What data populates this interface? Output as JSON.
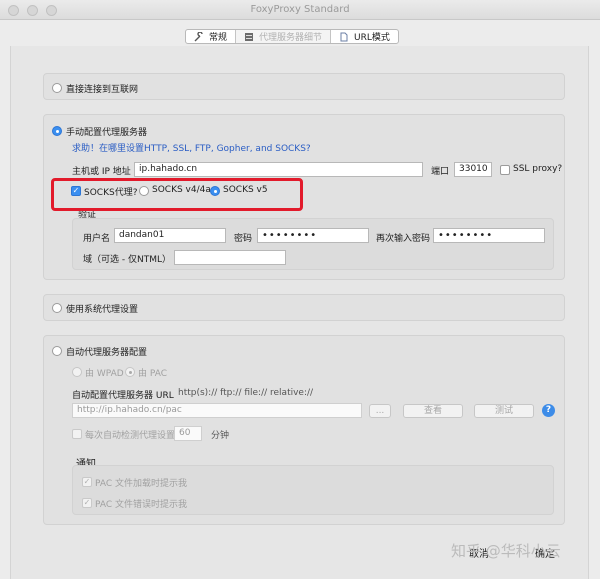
{
  "window": {
    "title": "FoxyProxy Standard"
  },
  "tabs": [
    {
      "label": "常规",
      "icon": "wrench-icon"
    },
    {
      "label": "代理服务器细节",
      "icon": "server-icon"
    },
    {
      "label": "URL模式",
      "icon": "document-icon"
    }
  ],
  "direct": {
    "label": "直接连接到互联网"
  },
  "manual": {
    "label": "手动配置代理服务器",
    "help_link": "求助！在哪里设置HTTP, SSL, FTP, Gopher, and SOCKS?",
    "host_label": "主机或 IP 地址",
    "host_value": "ip.hahado.cn",
    "port_label": "端口",
    "port_value": "33010",
    "ssl_proxy": "SSL proxy?",
    "socks_proxy": "SOCKS代理?",
    "socks_v4": "SOCKS v4/4a",
    "socks_v5": "SOCKS v5",
    "auth_title": "验证",
    "username_label": "用户名",
    "username_value": "dandan01",
    "password_label": "密码",
    "password_value": "••••••••",
    "password_repeat_label": "再次输入密码",
    "password_repeat_value": "••••••••",
    "domain_label": "域（可选 - 仅NTML）",
    "domain_value": ""
  },
  "system": {
    "label": "使用系统代理设置"
  },
  "auto": {
    "label": "自动代理服务器配置",
    "wpad": "由 WPAD",
    "pac": "由 PAC",
    "url_label": "自动配置代理服务器 URL",
    "url_hint": "http(s):// ftp:// file:// relative://",
    "url_placeholder": "http://ip.hahado.cn/pac",
    "browse": "...",
    "view": "查看",
    "test": "测试",
    "help": "?",
    "reload_label": "每次自动检测代理设置",
    "reload_value": "60",
    "reload_unit": "分钟",
    "notify_title": "通知",
    "notify_load": "PAC 文件加载时提示我",
    "notify_error": "PAC 文件错误时提示我"
  },
  "footer": {
    "cancel": "取消",
    "ok": "确定"
  },
  "watermark": "知乎 @华科小云",
  "colors": {
    "accent": "#3b8ff0",
    "highlight": "#e21a2b",
    "link": "#2a5dc4"
  }
}
